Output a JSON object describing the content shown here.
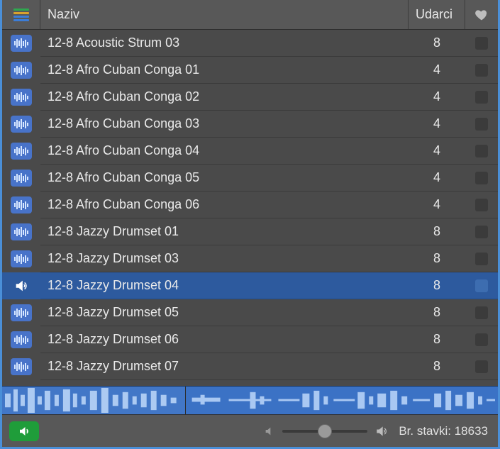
{
  "header": {
    "name_col": "Naziv",
    "beats_col": "Udarci"
  },
  "rows": [
    {
      "name": "12-8 Acoustic Strum 03",
      "beats": "8",
      "playing": false
    },
    {
      "name": "12-8 Afro Cuban Conga 01",
      "beats": "4",
      "playing": false
    },
    {
      "name": "12-8 Afro Cuban Conga 02",
      "beats": "4",
      "playing": false
    },
    {
      "name": "12-8 Afro Cuban Conga 03",
      "beats": "4",
      "playing": false
    },
    {
      "name": "12-8 Afro Cuban Conga 04",
      "beats": "4",
      "playing": false
    },
    {
      "name": "12-8 Afro Cuban Conga 05",
      "beats": "4",
      "playing": false
    },
    {
      "name": "12-8 Afro Cuban Conga 06",
      "beats": "4",
      "playing": false
    },
    {
      "name": "12-8 Jazzy Drumset 01",
      "beats": "8",
      "playing": false
    },
    {
      "name": "12-8 Jazzy Drumset 03",
      "beats": "8",
      "playing": false
    },
    {
      "name": "12-8 Jazzy Drumset 04",
      "beats": "8",
      "playing": true
    },
    {
      "name": "12-8 Jazzy Drumset 05",
      "beats": "8",
      "playing": false
    },
    {
      "name": "12-8 Jazzy Drumset 06",
      "beats": "8",
      "playing": false
    },
    {
      "name": "12-8 Jazzy Drumset 07",
      "beats": "8",
      "playing": false
    }
  ],
  "footer": {
    "items_label": "Br. stavki: 18633",
    "volume_percent": 50
  },
  "preview": {
    "progress_percent": 37
  },
  "colors": {
    "selection": "#2d5a9e",
    "loop_icon": "#4873c9",
    "preview_btn": "#1f9d3a"
  }
}
